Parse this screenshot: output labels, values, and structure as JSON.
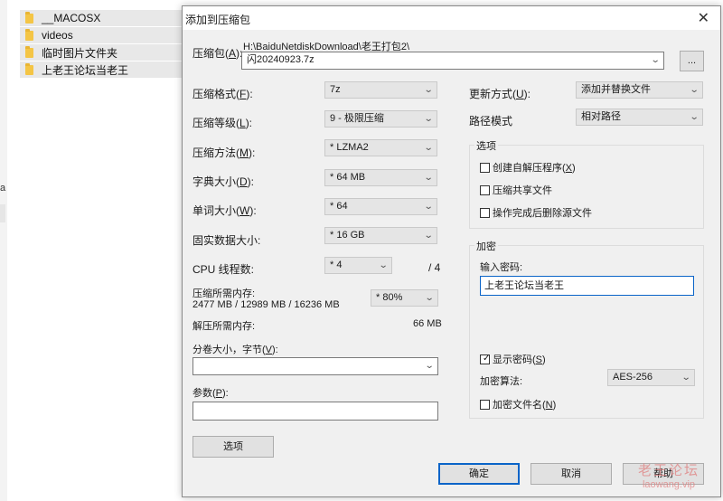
{
  "explorer": {
    "items": [
      {
        "name": "__MACOSX"
      },
      {
        "name": "videos"
      },
      {
        "name": "临时图片文件夹"
      },
      {
        "name": "上老王论坛当老王"
      }
    ],
    "stub_letter": "a"
  },
  "dialog": {
    "title": "添加到压缩包",
    "close_glyph": "✕",
    "archive": {
      "label": "压缩包(",
      "key": "A",
      "label_end": "):",
      "path": "H:\\BaiduNetdiskDownload\\老王打包2\\",
      "filename": "闪20240923.7z",
      "browse_label": "..."
    },
    "left": {
      "format": {
        "label": "压缩格式(",
        "key": "F",
        "end": "):",
        "value": "7z"
      },
      "level": {
        "label": "压缩等级(",
        "key": "L",
        "end": "):",
        "value": "9 - 极限压缩"
      },
      "method": {
        "label": "压缩方法(",
        "key": "M",
        "end": "):",
        "value": "* LZMA2"
      },
      "dict": {
        "label": "字典大小(",
        "key": "D",
        "end": "):",
        "value": "* 64 MB"
      },
      "word": {
        "label": "单词大小(",
        "key": "W",
        "end": "):",
        "value": "* 64"
      },
      "solid": {
        "label": "固实数据大小:",
        "value": "* 16 GB"
      },
      "threads": {
        "label": "CPU 线程数:",
        "value": "* 4",
        "total": "/ 4"
      },
      "mem_compress": {
        "label": "压缩所需内存:",
        "detail": "2477 MB / 12989 MB / 16236 MB",
        "percent": "* 80%"
      },
      "mem_decompress": {
        "label": "解压所需内存:",
        "value": "66 MB"
      },
      "volume": {
        "label": "分卷大小，字节(",
        "key": "V",
        "end": "):",
        "value": ""
      },
      "params": {
        "label": "参数(",
        "key": "P",
        "end": "):",
        "value": ""
      },
      "options_button": "选项"
    },
    "right": {
      "update": {
        "label": "更新方式(",
        "key": "U",
        "end": "):",
        "value": "添加并替换文件"
      },
      "path_mode": {
        "label": "路径模式",
        "value": "相对路径"
      },
      "options_group": {
        "title": "选项",
        "sfx": {
          "label": "创建自解压程序(",
          "key": "X",
          "end": ")",
          "checked": false
        },
        "shared": {
          "label": "压缩共享文件",
          "checked": false
        },
        "delete": {
          "label": "操作完成后删除源文件",
          "checked": false
        }
      },
      "encryption": {
        "title": "加密",
        "password_label": "输入密码:",
        "password_value": "上老王论坛当老王",
        "show_password": {
          "label": "显示密码(",
          "key": "S",
          "end": ")",
          "checked": true
        },
        "method_label": "加密算法:",
        "method_value": "AES-256",
        "encrypt_names": {
          "label": "加密文件名(",
          "key": "N",
          "end": ")",
          "checked": false
        }
      }
    },
    "buttons": {
      "ok": "确定",
      "cancel": "取消",
      "help": "帮助"
    },
    "check_glyph": "✓",
    "arrow_glyph": "⌄"
  },
  "watermark": {
    "line1": "老王论坛",
    "line2": "laowang.vip"
  }
}
